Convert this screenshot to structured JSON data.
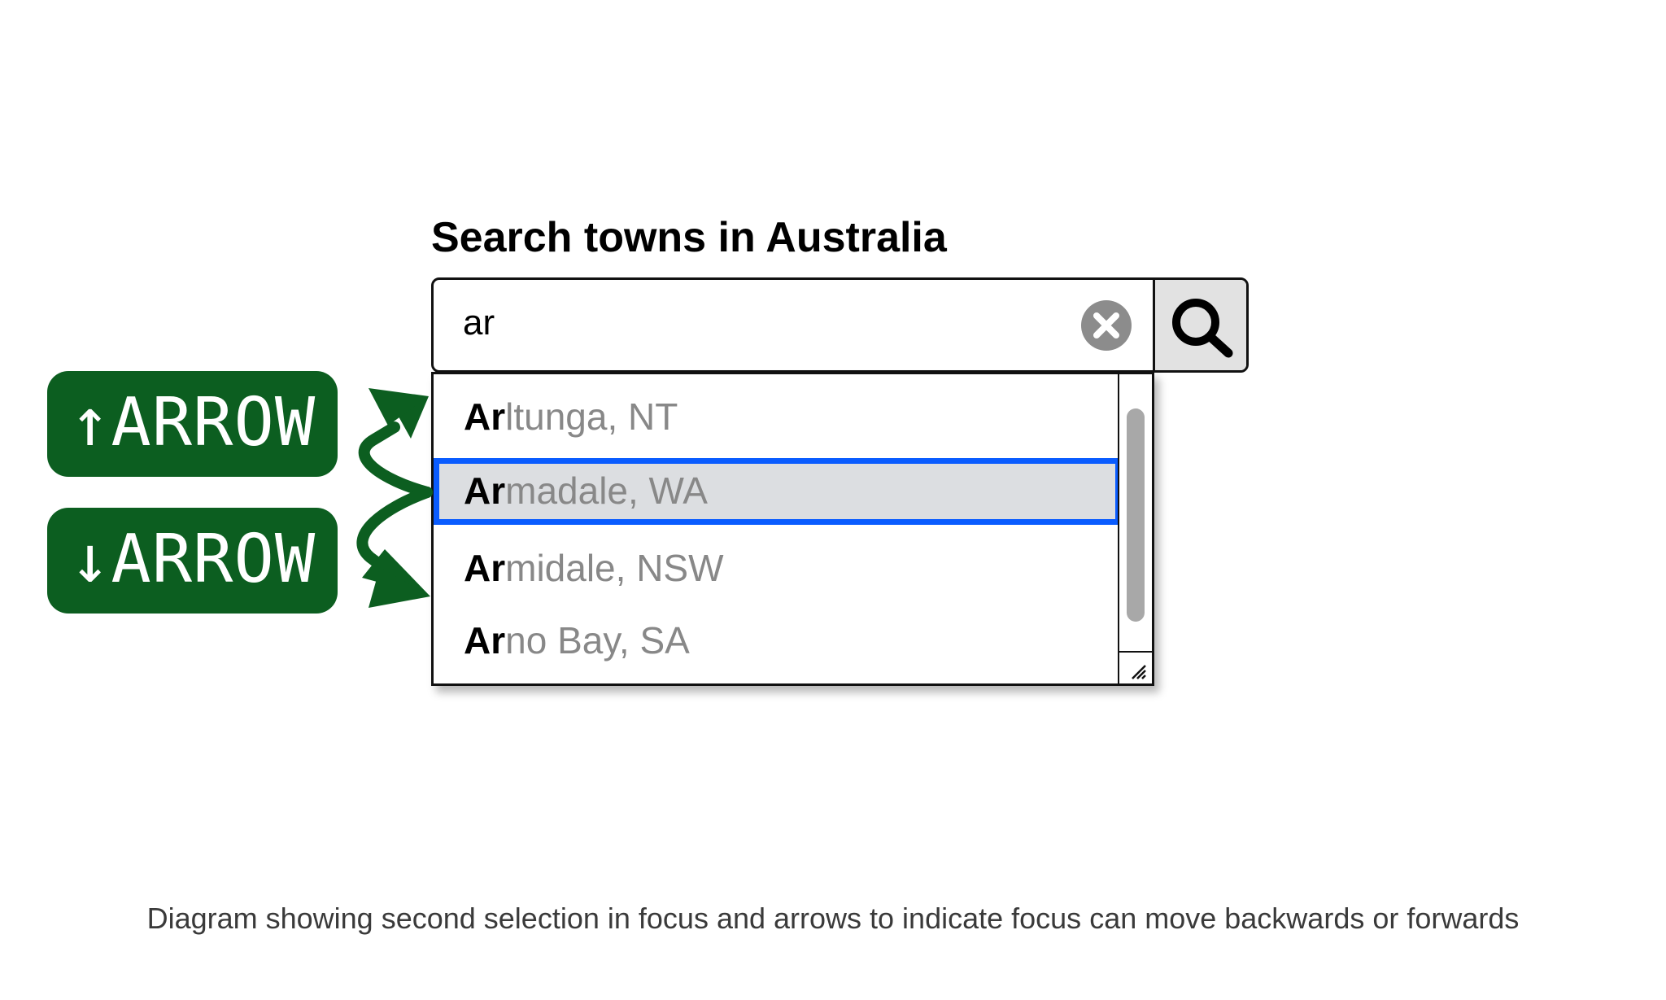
{
  "search": {
    "label": "Search towns in Australia",
    "value": "ar",
    "clear_icon": "clear-circle-x-icon",
    "search_icon": "magnifier-icon"
  },
  "listbox": {
    "options": [
      {
        "match": "Ar",
        "rest": "ltunga, NT",
        "selected": false
      },
      {
        "match": "Ar",
        "rest": "madale, WA",
        "selected": true
      },
      {
        "match": "Ar",
        "rest": "midale, NSW",
        "selected": false
      },
      {
        "match": "Ar",
        "rest": "no Bay, SA",
        "selected": false
      }
    ]
  },
  "keys": {
    "up": "↑ARROW",
    "down": "↓ARROW"
  },
  "colors": {
    "focus_outline": "#0a5cff",
    "key_background": "#0c5e20",
    "selected_background": "#dcdee1"
  },
  "caption": "Diagram showing second selection in focus and arrows to indicate focus can move backwards or forwards"
}
